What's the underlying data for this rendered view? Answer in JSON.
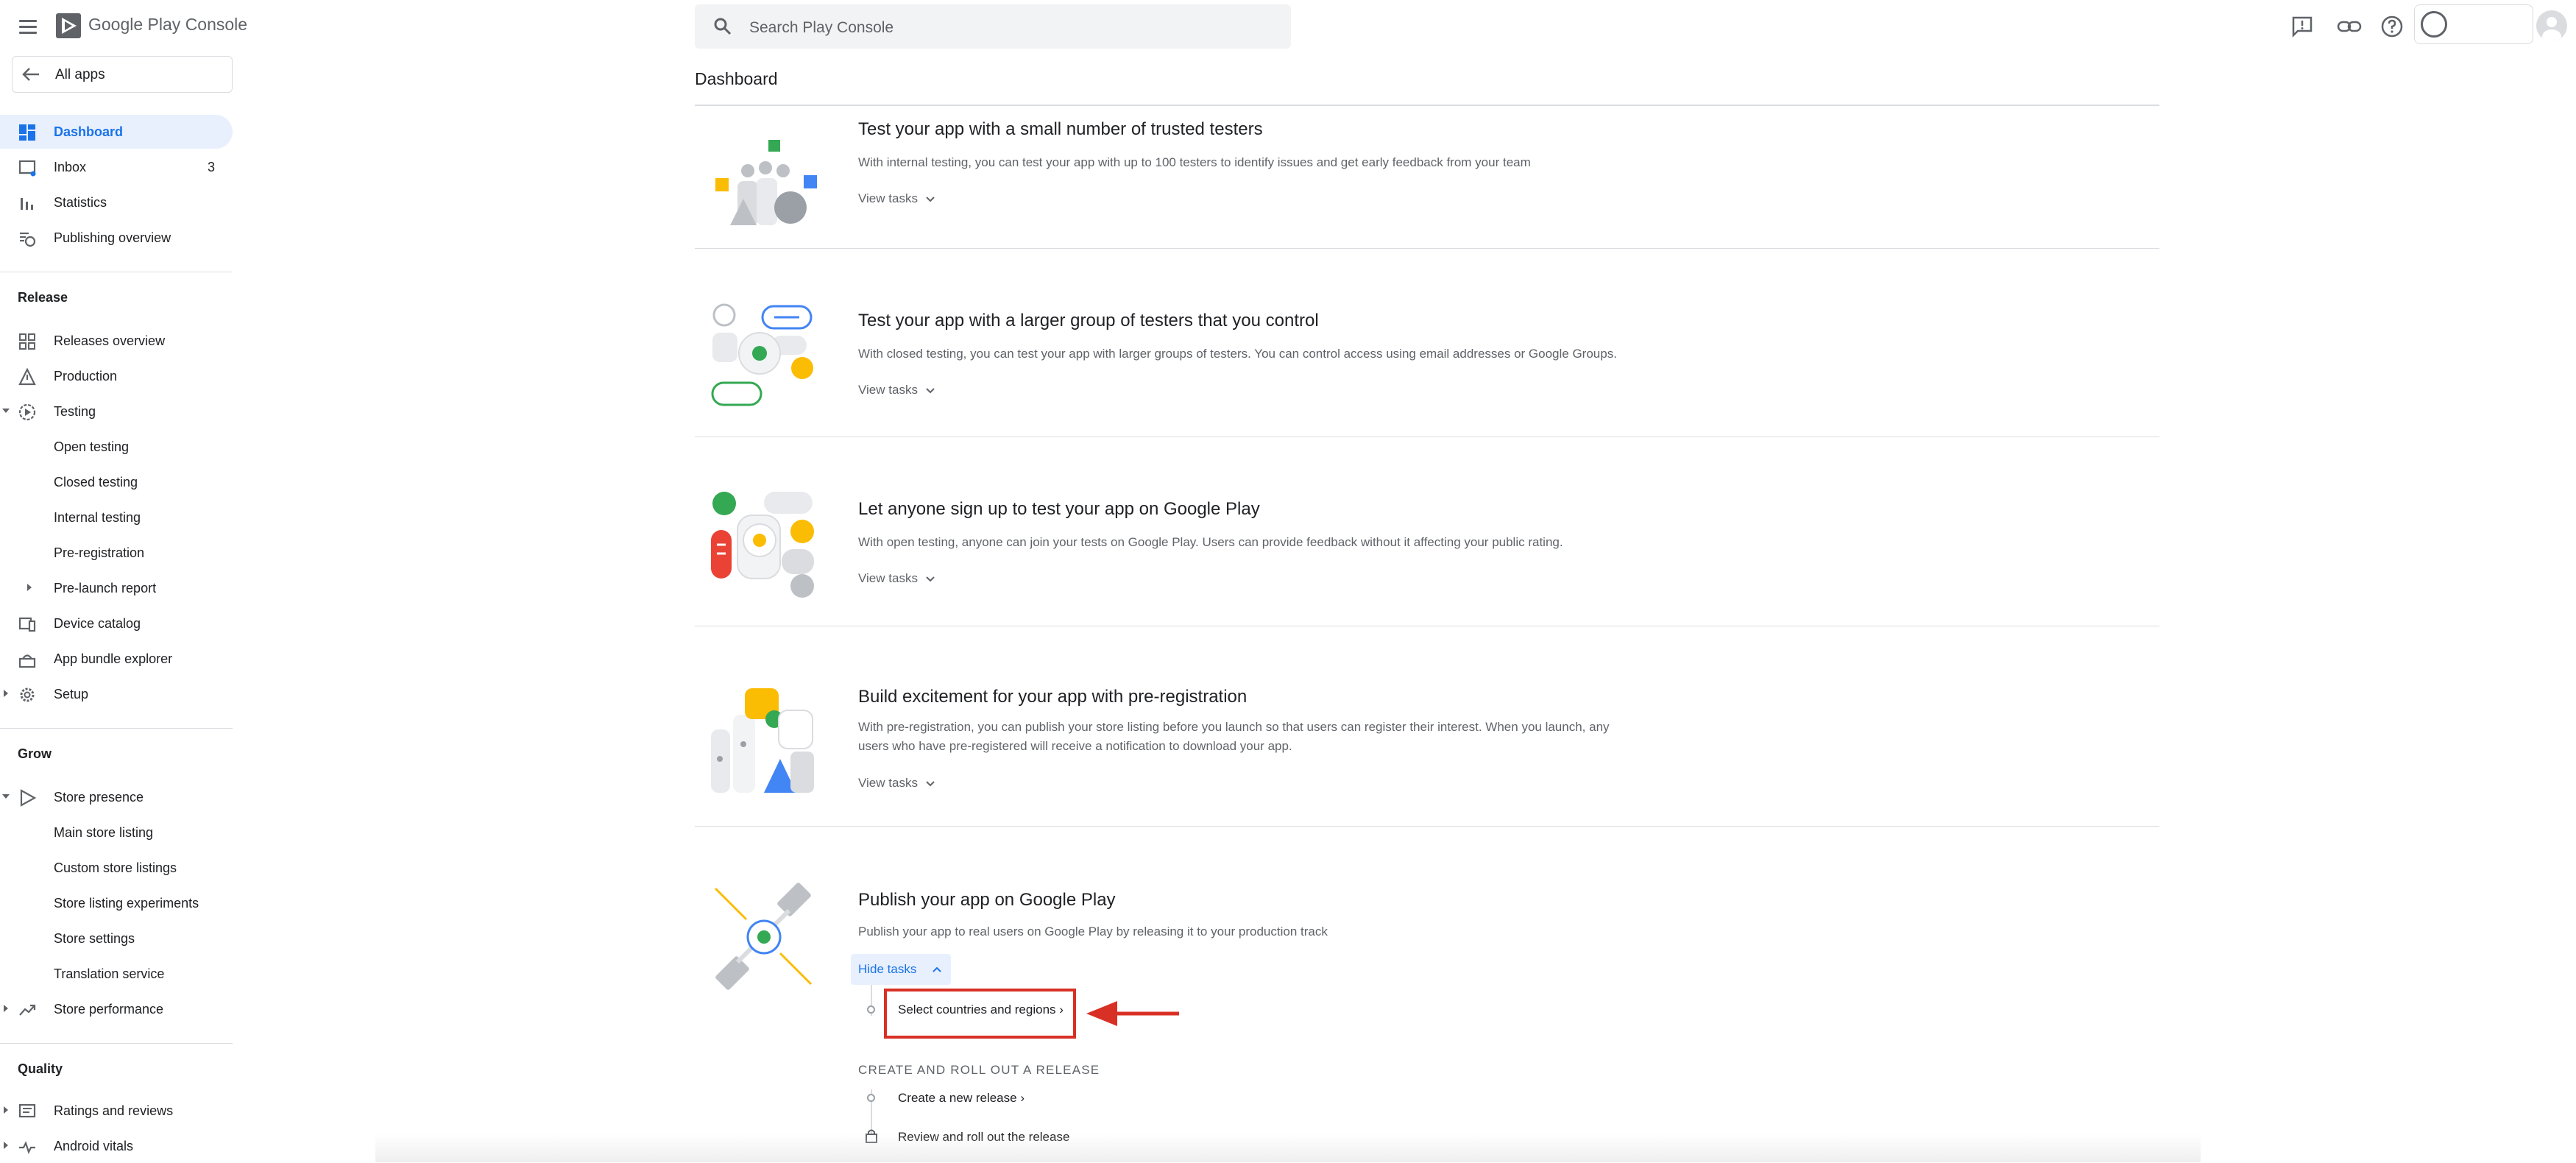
{
  "app": {
    "brand": "Google Play Console"
  },
  "search": {
    "placeholder": "Search Play Console"
  },
  "sidebar": {
    "all_apps": "All apps",
    "items": [
      {
        "label": "Dashboard",
        "active": true
      },
      {
        "label": "Inbox",
        "count": "3"
      },
      {
        "label": "Statistics"
      },
      {
        "label": "Publishing overview"
      }
    ],
    "release": {
      "heading": "Release",
      "items": [
        {
          "label": "Releases overview"
        },
        {
          "label": "Production"
        },
        {
          "label": "Testing"
        },
        {
          "label": "Open testing"
        },
        {
          "label": "Closed testing"
        },
        {
          "label": "Internal testing"
        },
        {
          "label": "Pre-registration"
        },
        {
          "label": "Pre-launch report"
        },
        {
          "label": "Device catalog"
        },
        {
          "label": "App bundle explorer"
        },
        {
          "label": "Setup"
        }
      ]
    },
    "grow": {
      "heading": "Grow",
      "items": [
        {
          "label": "Store presence"
        },
        {
          "label": "Main store listing"
        },
        {
          "label": "Custom store listings"
        },
        {
          "label": "Store listing experiments"
        },
        {
          "label": "Store settings"
        },
        {
          "label": "Translation service"
        },
        {
          "label": "Store performance"
        }
      ]
    },
    "quality": {
      "heading": "Quality",
      "items": [
        {
          "label": "Ratings and reviews"
        },
        {
          "label": "Android vitals"
        }
      ]
    }
  },
  "main": {
    "title": "Dashboard",
    "cards": [
      {
        "title": "Test your app with a small number of trusted testers",
        "description": "With internal testing, you can test your app with up to 100 testers to identify issues and get early feedback from your team",
        "action": "View tasks"
      },
      {
        "title": "Test your app with a larger group of testers that you control",
        "description": "With closed testing, you can test your app with larger groups of testers. You can control access using email addresses or Google Groups.",
        "action": "View tasks"
      },
      {
        "title": "Let anyone sign up to test your app on Google Play",
        "description": "With open testing, anyone can join your tests on Google Play. Users can provide feedback without it affecting your public rating.",
        "action": "View tasks"
      },
      {
        "title": "Build excitement for your app with pre-registration",
        "description": "With pre-registration, you can publish your store listing before you launch so that users can register their interest. When you launch, any users who have pre-registered will receive a notification to download your app.",
        "action": "View tasks"
      },
      {
        "title": "Publish your app on Google Play",
        "description": "Publish your app to real users on Google Play by releasing it to your production track",
        "action": "Hide tasks",
        "steps": [
          {
            "label": "Select countries and regions ›"
          }
        ],
        "section_heading": "CREATE AND ROLL OUT A RELEASE",
        "section_steps": [
          {
            "label": "Create a new release ›"
          },
          {
            "label": "Review and roll out the release"
          }
        ]
      }
    ]
  },
  "colors": {
    "accent": "#1a73e8",
    "annotation": "#d93025",
    "active_bg": "#e8f0fe"
  },
  "icons": [
    "menu-icon",
    "play-console-logo",
    "search-icon",
    "feedback-icon",
    "link-icon",
    "help-icon",
    "account-icon",
    "avatar-icon"
  ]
}
